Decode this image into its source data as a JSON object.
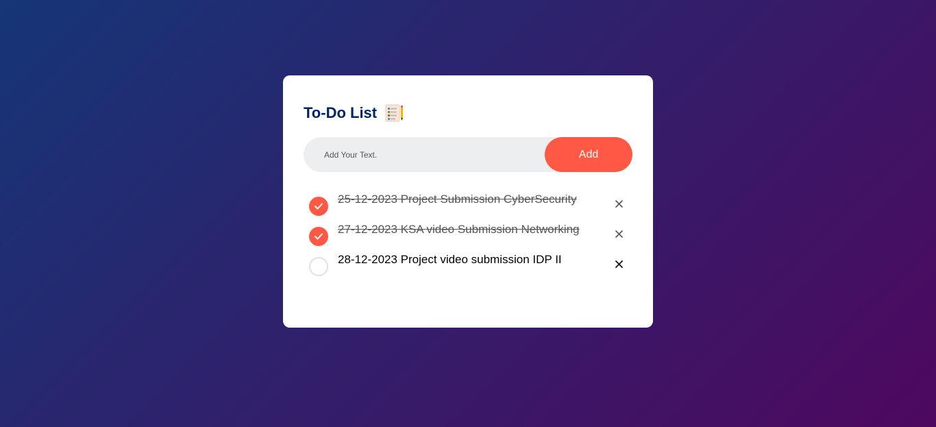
{
  "app": {
    "title": "To-Do List",
    "title_icon": "checklist-notepad-icon"
  },
  "input": {
    "placeholder": "Add Your Text.",
    "value": ""
  },
  "add_button": {
    "label": "Add"
  },
  "tasks": [
    {
      "text": "25-12-2023 Project Submission CyberSecurity",
      "checked": true
    },
    {
      "text": "27-12-2023 KSA video Submission Networking",
      "checked": true
    },
    {
      "text": "28-12-2023 Project video submission IDP II",
      "checked": false
    }
  ],
  "colors": {
    "accent": "#ff5945",
    "title": "#002765",
    "gradient_start": "#153677",
    "gradient_end": "#4e085f",
    "input_bg": "#edeef0"
  },
  "icons": {
    "checked": "check-icon",
    "remove": "close-icon"
  }
}
